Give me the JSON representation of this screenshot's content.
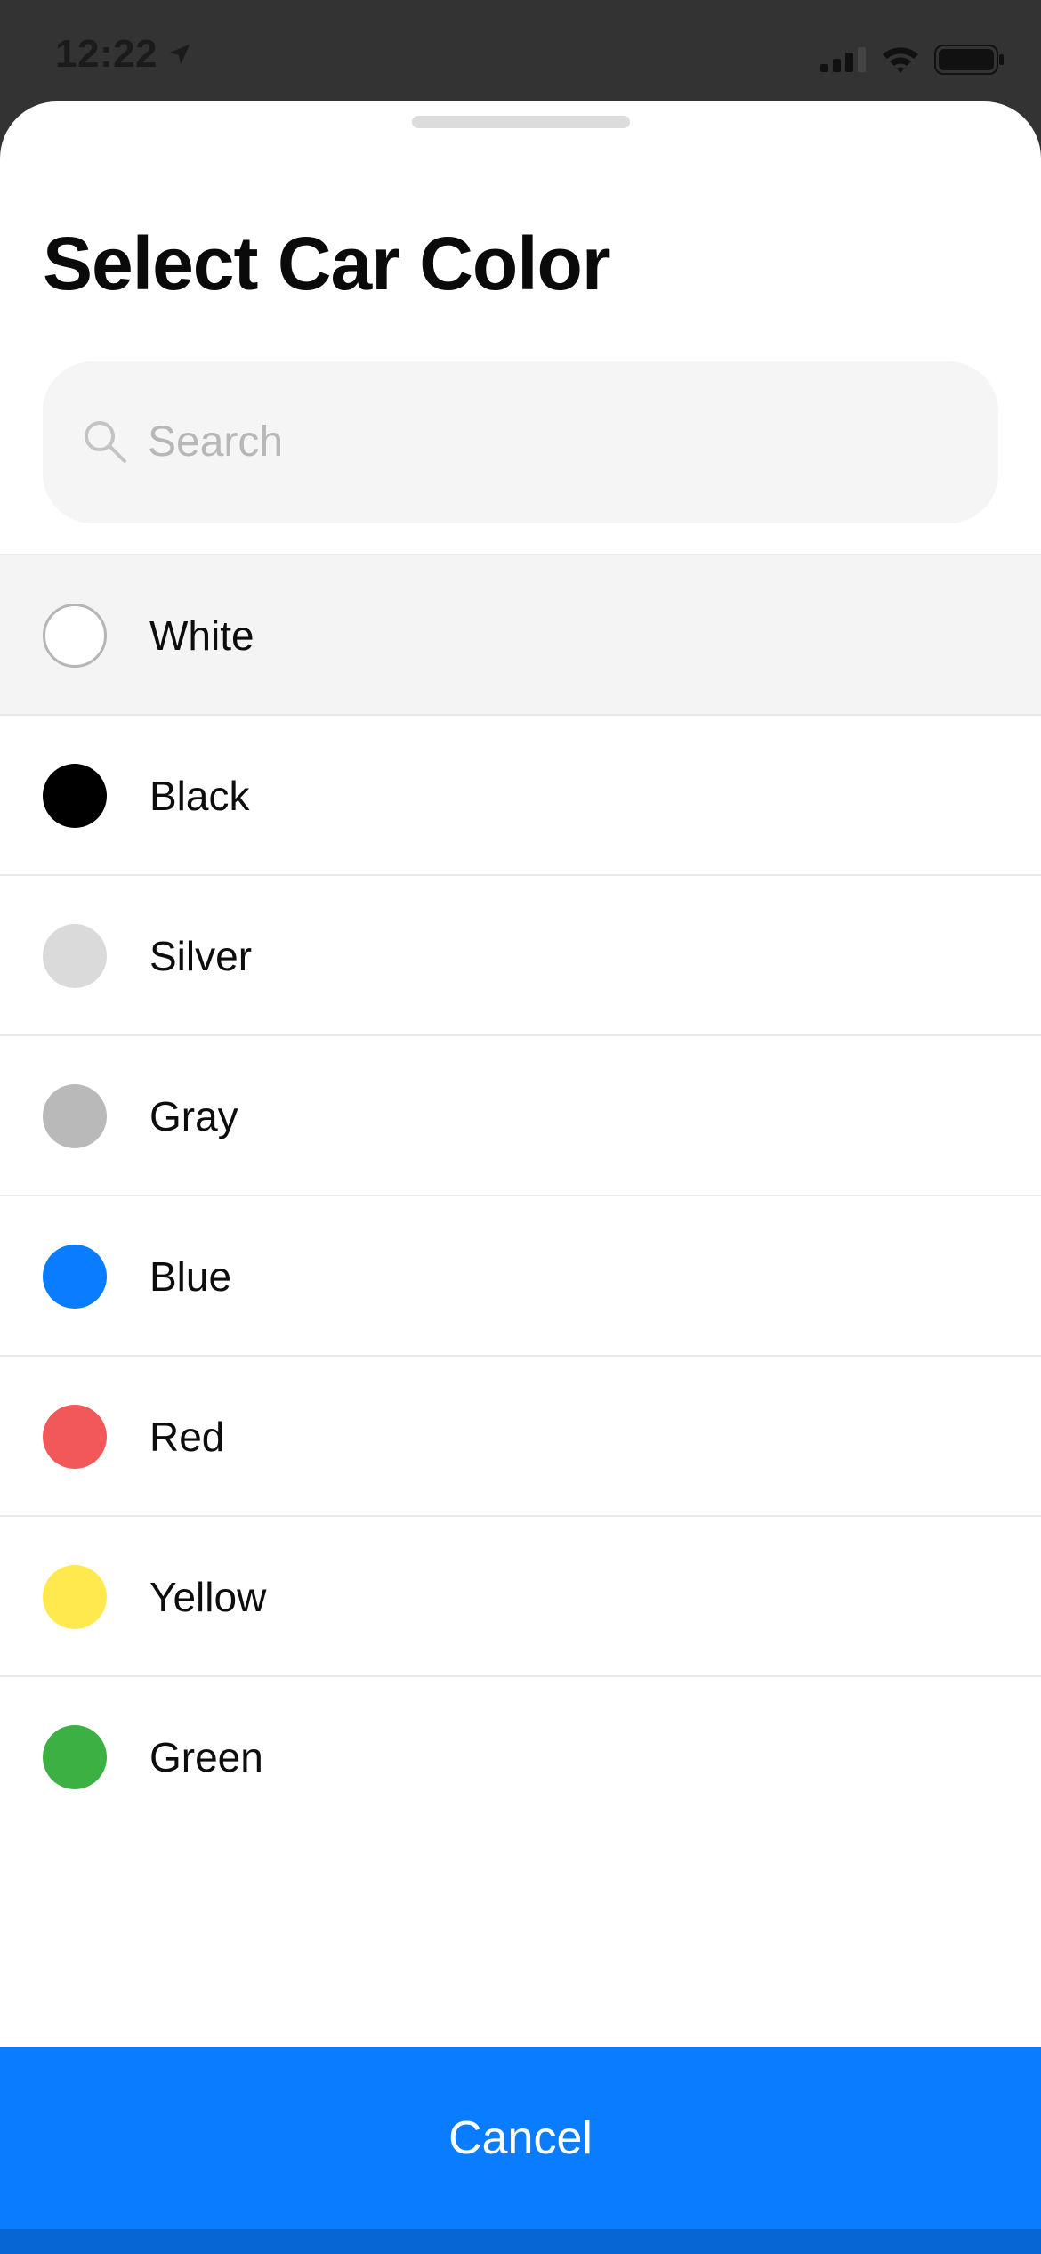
{
  "status_bar": {
    "time": "12:22",
    "location_icon": "location-arrow-icon",
    "signal_icon": "cellular-signal-icon",
    "wifi_icon": "wifi-icon",
    "battery_icon": "battery-icon"
  },
  "sheet": {
    "title": "Select Car Color",
    "search": {
      "placeholder": "Search",
      "value": "",
      "icon": "search-icon"
    },
    "colors": [
      {
        "label": "White",
        "swatch": "#ffffff",
        "selected": true
      },
      {
        "label": "Black",
        "swatch": "#000000",
        "selected": false
      },
      {
        "label": "Silver",
        "swatch": "#dadada",
        "selected": false
      },
      {
        "label": "Gray",
        "swatch": "#b9b9b9",
        "selected": false
      },
      {
        "label": "Blue",
        "swatch": "#0a7cff",
        "selected": false
      },
      {
        "label": "Red",
        "swatch": "#f2585a",
        "selected": false
      },
      {
        "label": "Yellow",
        "swatch": "#ffe94e",
        "selected": false
      },
      {
        "label": "Green",
        "swatch": "#3cb043",
        "selected": false
      }
    ],
    "cancel_label": "Cancel"
  },
  "theme": {
    "accent": "#0a7cff",
    "accent_dark": "#0866d4",
    "selected_row": "#f4f4f4",
    "status_bar_bg": "#333333"
  }
}
